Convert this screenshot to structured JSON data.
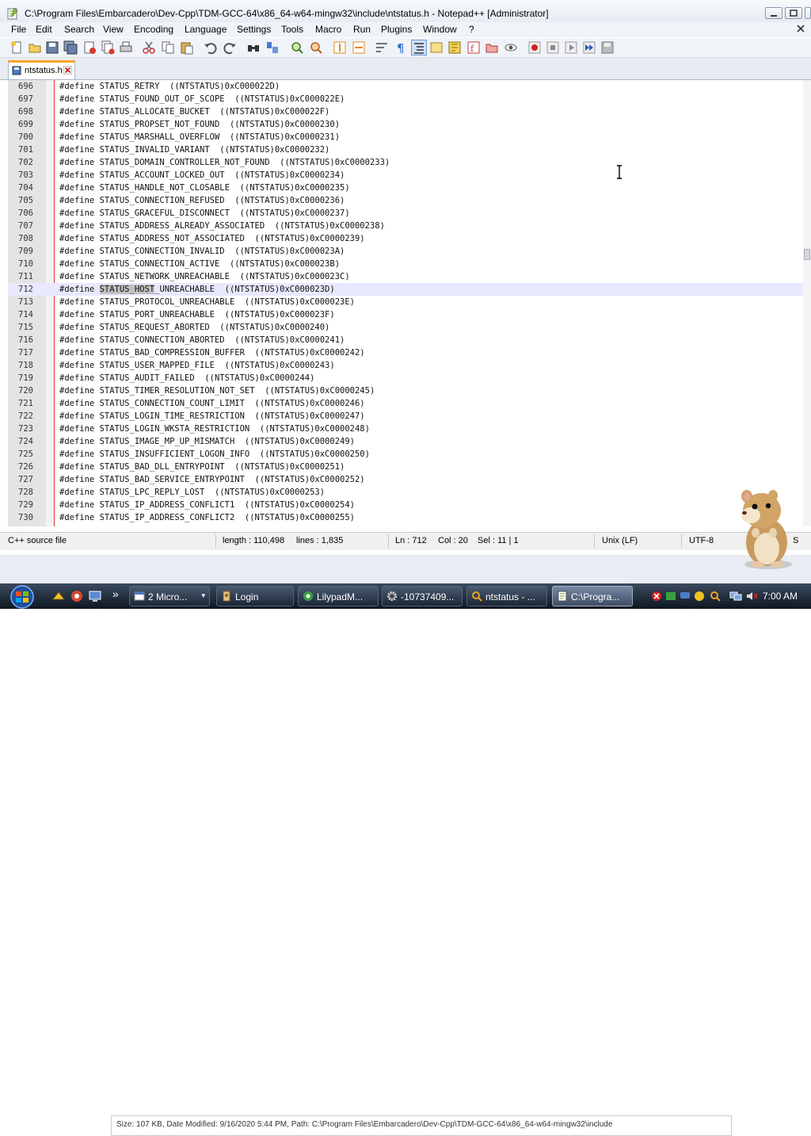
{
  "window": {
    "title": "C:\\Program Files\\Embarcadero\\Dev-Cpp\\TDM-GCC-64\\x86_64-w64-mingw32\\include\\ntstatus.h - Notepad++ [Administrator]"
  },
  "menu": [
    "File",
    "Edit",
    "Search",
    "View",
    "Encoding",
    "Language",
    "Settings",
    "Tools",
    "Macro",
    "Run",
    "Plugins",
    "Window",
    "?"
  ],
  "tab": {
    "label": "ntstatus.h"
  },
  "editor": {
    "lines": [
      {
        "num": "696",
        "prefix": "#define ",
        "name": "STATUS_RETRY",
        "value": "  ((NTSTATUS)0xC000022D)"
      },
      {
        "num": "697",
        "prefix": "#define ",
        "name": "STATUS_FOUND_OUT_OF_SCOPE",
        "value": "  ((NTSTATUS)0xC000022E)"
      },
      {
        "num": "698",
        "prefix": "#define ",
        "name": "STATUS_ALLOCATE_BUCKET",
        "value": "  ((NTSTATUS)0xC000022F)"
      },
      {
        "num": "699",
        "prefix": "#define ",
        "name": "STATUS_PROPSET_NOT_FOUND",
        "value": "  ((NTSTATUS)0xC0000230)"
      },
      {
        "num": "700",
        "prefix": "#define ",
        "name": "STATUS_MARSHALL_OVERFLOW",
        "value": "  ((NTSTATUS)0xC0000231)"
      },
      {
        "num": "701",
        "prefix": "#define ",
        "name": "STATUS_INVALID_VARIANT",
        "value": "  ((NTSTATUS)0xC0000232)"
      },
      {
        "num": "702",
        "prefix": "#define ",
        "name": "STATUS_DOMAIN_CONTROLLER_NOT_FOUND",
        "value": "  ((NTSTATUS)0xC0000233)"
      },
      {
        "num": "703",
        "prefix": "#define ",
        "name": "STATUS_ACCOUNT_LOCKED_OUT",
        "value": "  ((NTSTATUS)0xC0000234)"
      },
      {
        "num": "704",
        "prefix": "#define ",
        "name": "STATUS_HANDLE_NOT_CLOSABLE",
        "value": "  ((NTSTATUS)0xC0000235)"
      },
      {
        "num": "705",
        "prefix": "#define ",
        "name": "STATUS_CONNECTION_REFUSED",
        "value": "  ((NTSTATUS)0xC0000236)"
      },
      {
        "num": "706",
        "prefix": "#define ",
        "name": "STATUS_GRACEFUL_DISCONNECT",
        "value": "  ((NTSTATUS)0xC0000237)"
      },
      {
        "num": "707",
        "prefix": "#define ",
        "name": "STATUS_ADDRESS_ALREADY_ASSOCIATED",
        "value": "  ((NTSTATUS)0xC0000238)"
      },
      {
        "num": "708",
        "prefix": "#define ",
        "name": "STATUS_ADDRESS_NOT_ASSOCIATED",
        "value": "  ((NTSTATUS)0xC0000239)"
      },
      {
        "num": "709",
        "prefix": "#define ",
        "name": "STATUS_CONNECTION_INVALID",
        "value": "  ((NTSTATUS)0xC000023A)"
      },
      {
        "num": "710",
        "prefix": "#define ",
        "name": "STATUS_CONNECTION_ACTIVE",
        "value": "  ((NTSTATUS)0xC000023B)"
      },
      {
        "num": "711",
        "prefix": "#define ",
        "name": "STATUS_NETWORK_UNREACHABLE",
        "value": "  ((NTSTATUS)0xC000023C)"
      },
      {
        "num": "712",
        "prefix": "#define ",
        "name": "STATUS_HOST_UNREACHABLE",
        "value": "  ((NTSTATUS)0xC000023D)",
        "current": true,
        "selected": "STATUS_HOST"
      },
      {
        "num": "713",
        "prefix": "#define ",
        "name": "STATUS_PROTOCOL_UNREACHABLE",
        "value": "  ((NTSTATUS)0xC000023E)"
      },
      {
        "num": "714",
        "prefix": "#define ",
        "name": "STATUS_PORT_UNREACHABLE",
        "value": "  ((NTSTATUS)0xC000023F)"
      },
      {
        "num": "715",
        "prefix": "#define ",
        "name": "STATUS_REQUEST_ABORTED",
        "value": "  ((NTSTATUS)0xC0000240)"
      },
      {
        "num": "716",
        "prefix": "#define ",
        "name": "STATUS_CONNECTION_ABORTED",
        "value": "  ((NTSTATUS)0xC0000241)"
      },
      {
        "num": "717",
        "prefix": "#define ",
        "name": "STATUS_BAD_COMPRESSION_BUFFER",
        "value": "  ((NTSTATUS)0xC0000242)"
      },
      {
        "num": "718",
        "prefix": "#define ",
        "name": "STATUS_USER_MAPPED_FILE",
        "value": "  ((NTSTATUS)0xC0000243)"
      },
      {
        "num": "719",
        "prefix": "#define ",
        "name": "STATUS_AUDIT_FAILED",
        "value": "  ((NTSTATUS)0xC0000244)"
      },
      {
        "num": "720",
        "prefix": "#define ",
        "name": "STATUS_TIMER_RESOLUTION_NOT_SET",
        "value": "  ((NTSTATUS)0xC0000245)"
      },
      {
        "num": "721",
        "prefix": "#define ",
        "name": "STATUS_CONNECTION_COUNT_LIMIT",
        "value": "  ((NTSTATUS)0xC0000246)"
      },
      {
        "num": "722",
        "prefix": "#define ",
        "name": "STATUS_LOGIN_TIME_RESTRICTION",
        "value": "  ((NTSTATUS)0xC0000247)"
      },
      {
        "num": "723",
        "prefix": "#define ",
        "name": "STATUS_LOGIN_WKSTA_RESTRICTION",
        "value": "  ((NTSTATUS)0xC0000248)"
      },
      {
        "num": "724",
        "prefix": "#define ",
        "name": "STATUS_IMAGE_MP_UP_MISMATCH",
        "value": "  ((NTSTATUS)0xC0000249)"
      },
      {
        "num": "725",
        "prefix": "#define ",
        "name": "STATUS_INSUFFICIENT_LOGON_INFO",
        "value": "  ((NTSTATUS)0xC0000250)"
      },
      {
        "num": "726",
        "prefix": "#define ",
        "name": "STATUS_BAD_DLL_ENTRYPOINT",
        "value": "  ((NTSTATUS)0xC0000251)"
      },
      {
        "num": "727",
        "prefix": "#define ",
        "name": "STATUS_BAD_SERVICE_ENTRYPOINT",
        "value": "  ((NTSTATUS)0xC0000252)"
      },
      {
        "num": "728",
        "prefix": "#define ",
        "name": "STATUS_LPC_REPLY_LOST",
        "value": "  ((NTSTATUS)0xC0000253)"
      },
      {
        "num": "729",
        "prefix": "#define ",
        "name": "STATUS_IP_ADDRESS_CONFLICT1",
        "value": "  ((NTSTATUS)0xC0000254)"
      },
      {
        "num": "730",
        "prefix": "#define ",
        "name": "STATUS_IP_ADDRESS_CONFLICT2",
        "value": "  ((NTSTATUS)0xC0000255)"
      }
    ]
  },
  "statusbar": {
    "language": "C++ source file",
    "length": "length : 110,498",
    "lines": "lines : 1,835",
    "ln": "Ln : 712",
    "col": "Col : 20",
    "sel": "Sel : 11 | 1",
    "eol": "Unix (LF)",
    "encoding": "UTF-8",
    "mode": "S"
  },
  "explorer": {
    "details": "Size: 107 KB, Date Modified: 9/16/2020 5:44 PM, Path: C:\\Program Files\\Embarcadero\\Dev-Cpp\\TDM-GCC-64\\x86_64-w64-mingw32\\include"
  },
  "taskbar": {
    "overflow": "»",
    "tasks": [
      {
        "label": "2 Micro...",
        "icon": "window-icon"
      },
      {
        "label": "Login",
        "icon": "login-icon"
      },
      {
        "label": "LilypadM...",
        "icon": "lilypad-icon"
      },
      {
        "label": "-10737409...",
        "icon": "gear-icon"
      },
      {
        "label": "ntstatus - ...",
        "icon": "search-icon"
      },
      {
        "label": "C:\\Progra...",
        "icon": "notepad-icon"
      }
    ],
    "clock": "7:00 AM"
  }
}
